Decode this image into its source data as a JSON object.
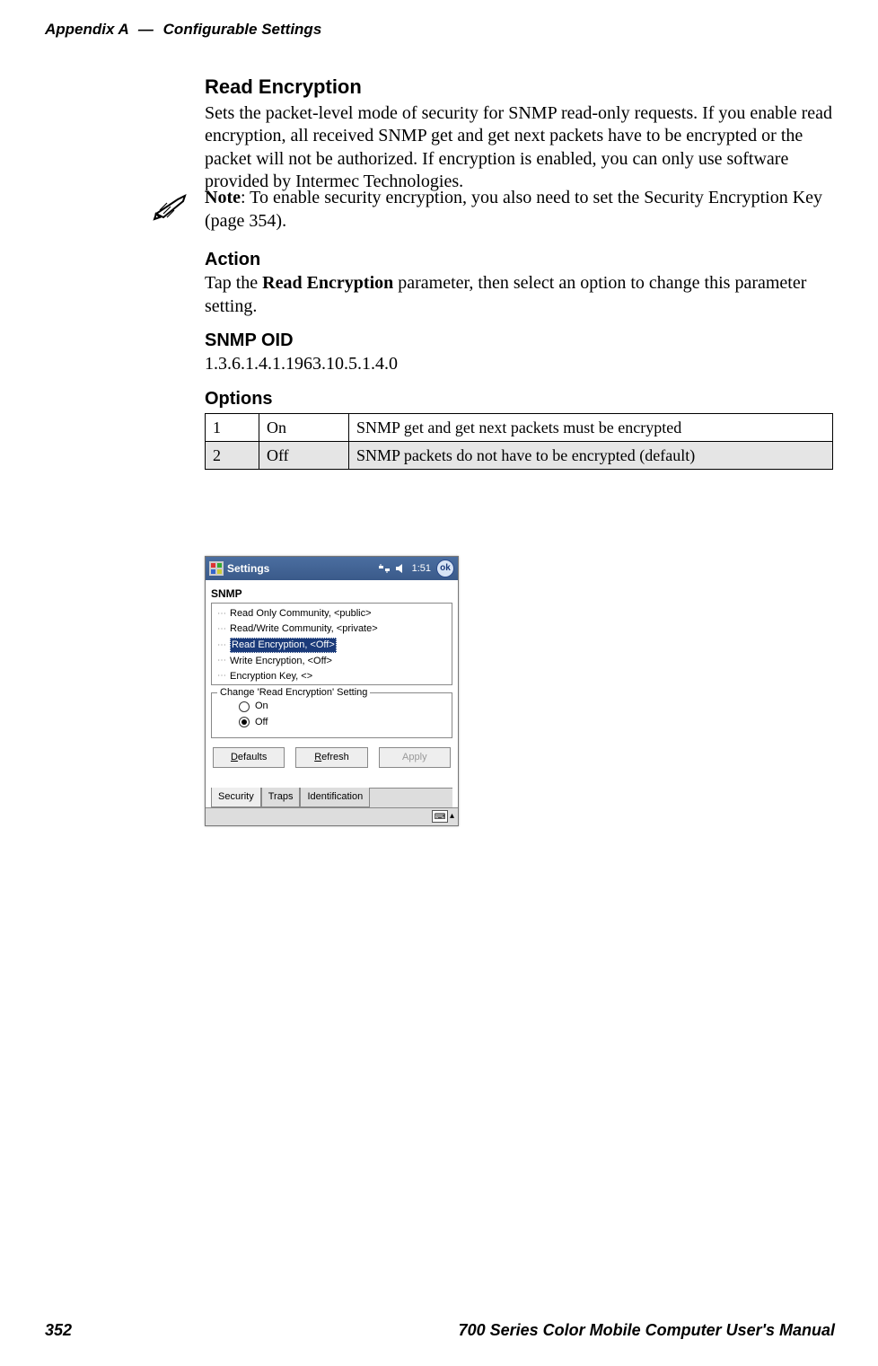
{
  "header": {
    "appendix_label": "Appendix A",
    "dash": "—",
    "section_label": "Configurable Settings"
  },
  "section": {
    "title": "Read Encryption",
    "intro": "Sets the packet-level mode of security for SNMP read-only requests. If you enable read encryption, all received SNMP get and get next packets have to be encrypted or the packet will not be authorized. If encryption is enabled, you can only use software provided by Intermec Technologies."
  },
  "note": {
    "label": "Note",
    "text": ": To enable security encryption, you also need to set the Security Encryption Key (page 354)."
  },
  "action": {
    "title": "Action",
    "prefix": "Tap the ",
    "param": "Read Encryption",
    "suffix": " parameter, then select an option to change this parameter setting."
  },
  "oid": {
    "title": "SNMP OID",
    "value": "1.3.6.1.4.1.1963.10.5.1.4.0"
  },
  "options": {
    "title": "Options",
    "rows": [
      {
        "code": "1",
        "state": "On",
        "desc": "SNMP get and get next packets must be encrypted"
      },
      {
        "code": "2",
        "state": "Off",
        "desc": "SNMP packets do not have to be encrypted (default)"
      }
    ]
  },
  "device": {
    "title": "Settings",
    "time": "1:51",
    "ok": "ok",
    "caption": "SNMP",
    "tree": [
      "Read Only Community, <public>",
      "Read/Write Community, <private>",
      "Read Encryption, <Off>",
      "Write Encryption, <Off>",
      "Encryption Key, <>"
    ],
    "selected_index": 2,
    "fieldset_legend": "Change 'Read Encryption' Setting",
    "radio_on": "On",
    "radio_off": "Off",
    "buttons": {
      "defaults": "Defaults",
      "refresh": "Refresh",
      "apply": "Apply"
    },
    "tabs": [
      "Security",
      "Traps",
      "Identification"
    ]
  },
  "footer": {
    "page": "352",
    "manual": "700 Series Color Mobile Computer User's Manual"
  }
}
